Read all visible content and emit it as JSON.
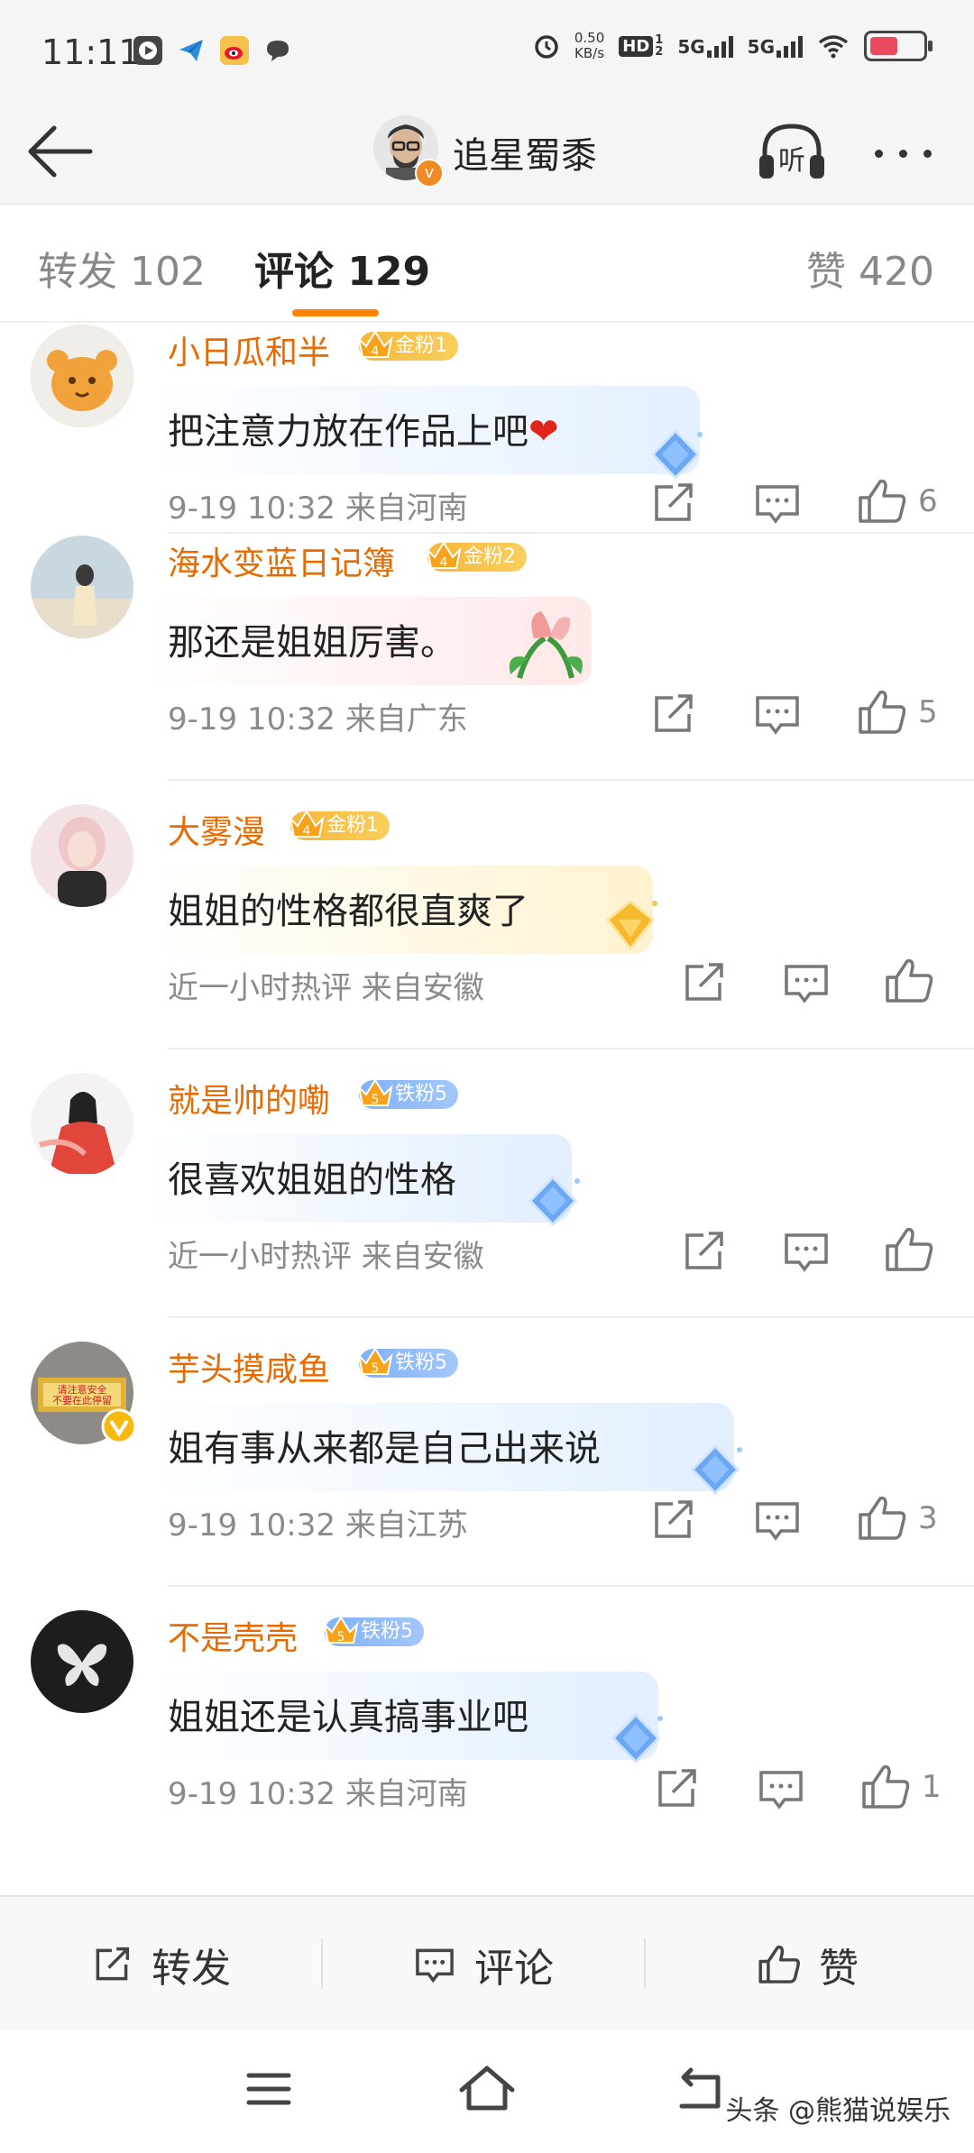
{
  "status_bar": {
    "time": "11:11",
    "net_speed_value": "0.50",
    "net_speed_unit": "KB/s",
    "hd_label": "HD",
    "hd_sub": "1",
    "hd_sub2": "2",
    "net1": "5G",
    "net2": "5G"
  },
  "header": {
    "username": "追星蜀黍",
    "listen_label": "听"
  },
  "tabs": [
    {
      "label": "转发 102"
    },
    {
      "label": "评论 129"
    },
    {
      "label": "赞 420"
    }
  ],
  "comments": [
    {
      "name": "小日瓜和半",
      "badge": "金粉1",
      "badge_level": "4",
      "text": "把注意力放在作品上吧",
      "heart": "❤",
      "meta": "9-19 10:32  来自河南",
      "likes": "6"
    },
    {
      "name": "海水变蓝日记簿",
      "badge": "金粉2",
      "badge_level": "4",
      "text": "那还是姐姐厉害。",
      "meta": "9-19 10:32  来自广东",
      "likes": "5"
    },
    {
      "name": "大雾漫",
      "badge": "金粉1",
      "badge_level": "4",
      "text": "姐姐的性格都很直爽了",
      "meta": "近一小时热评  来自安徽",
      "likes": ""
    },
    {
      "name": "就是帅的嘞",
      "badge": "铁粉5",
      "badge_level": "5",
      "text": "很喜欢姐姐的性格",
      "meta": "近一小时热评  来自安徽",
      "likes": ""
    },
    {
      "name": "芋头摸咸鱼",
      "badge": "铁粉5",
      "badge_level": "5",
      "text": "姐有事从来都是自己出来说",
      "meta": "9-19 10:32  来自江苏",
      "likes": "3",
      "avatar_sign_1": "请注意安全",
      "avatar_sign_2": "不要在此停留"
    },
    {
      "name": "不是壳壳",
      "badge": "铁粉5",
      "badge_level": "5",
      "text": "姐姐还是认真搞事业吧",
      "meta": "9-19 10:32  来自河南",
      "likes": "1"
    }
  ],
  "bottom_bar": {
    "repost": "转发",
    "comment": "评论",
    "like": "赞"
  },
  "watermark": "头条 @熊猫说娱乐",
  "colors": {
    "accent_orange": "#ff8200",
    "name_orange": "#e86a00",
    "gold_badge": "#f7b638",
    "iron_badge": "#7fb1f7"
  }
}
